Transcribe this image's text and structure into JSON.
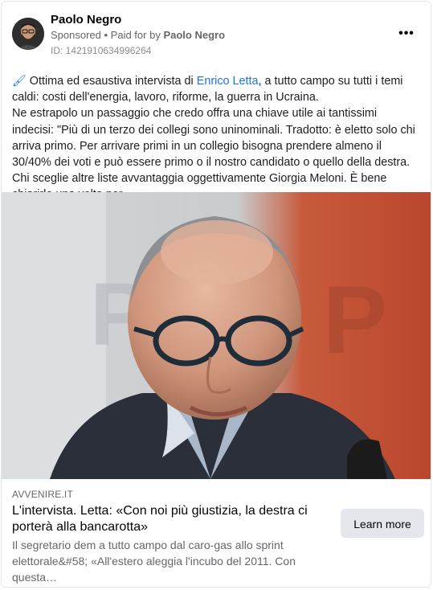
{
  "post": {
    "page_name": "Paolo Negro",
    "sponsored_label": "Sponsored",
    "paid_for_prefix": "• Paid for by",
    "paid_for_by": "Paolo Negro",
    "ad_id": "ID: 1421910634996264",
    "more_icon": "more-horizontal-icon",
    "text": {
      "emoji": "🖌",
      "line1_before": "Ottima ed esaustiva intervista di",
      "link": "Enrico Letta",
      "line1_after": ", a tutto campo su tutti i temi caldi: costi dell'energia, lavoro, riforme, la guerra in Ucraina.",
      "paragraph2": "Ne estrapolo un passaggio che credo offra una chiave utile ai tantissimi indecisi: \"Più di un terzo dei collegi sono uninominali. Tradotto: è eletto solo chi arriva primo. Per arrivare primi in un collegio bisogna prendere almeno il 30/40% dei voti e può essere primo o il nostro candidato o quello della destra. Chi sceglie altre liste avvantaggia oggettivamente Giorgia Meloni. È bene chiarirlo una volta per…"
    }
  },
  "link_preview": {
    "domain": "AVVENIRE.IT",
    "headline": "L'intervista. Letta: «Con noi più giustizia, la destra ci porterà alla bancarotta»",
    "description": "Il segretario dem a tutto campo dal caro-gas allo sprint elettorale&#58; «All'estero aleggia l'incubo del 2011. Con questa…",
    "cta": "Learn more"
  },
  "colors": {
    "link": "#1b74e4",
    "secondary_text": "#65676b",
    "button_bg": "#e4e6eb"
  }
}
